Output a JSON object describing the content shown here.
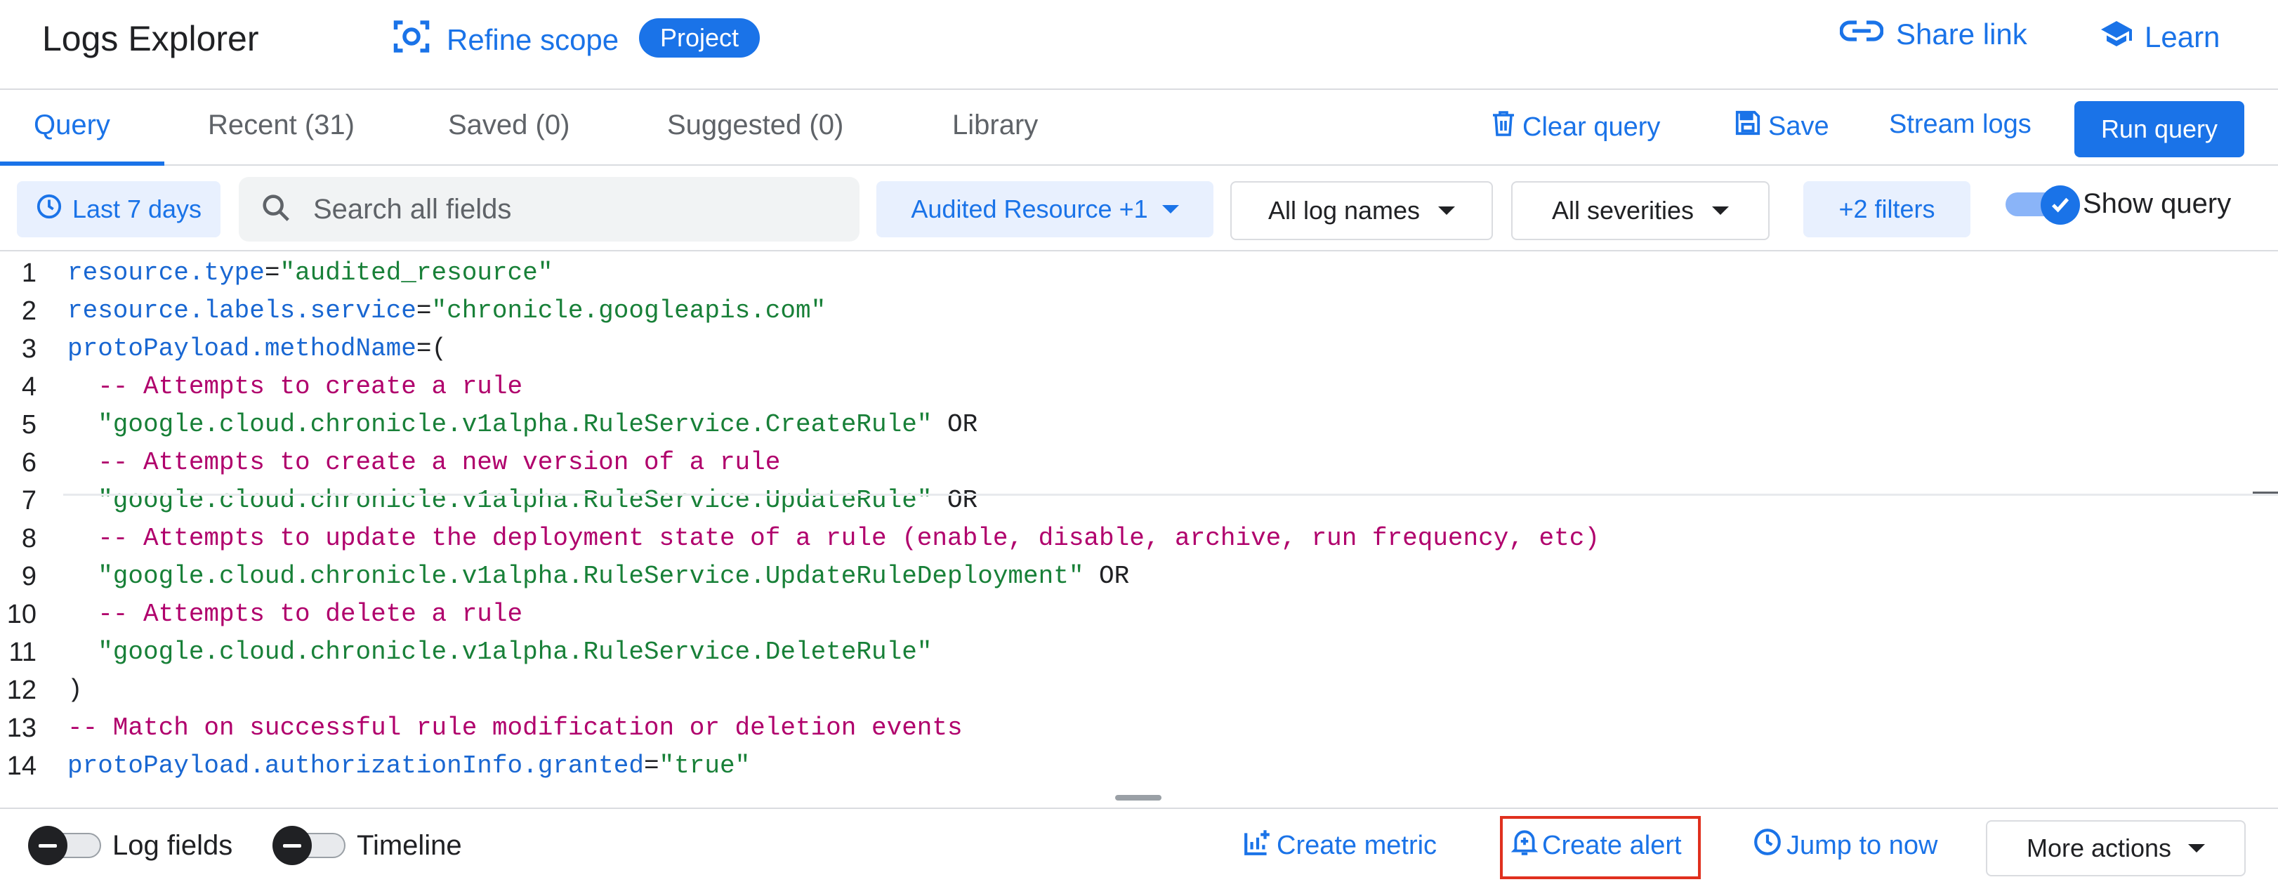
{
  "header": {
    "title": "Logs Explorer",
    "refine_scope": "Refine scope",
    "project_badge": "Project",
    "share_link": "Share link",
    "learn": "Learn"
  },
  "tabs": {
    "items": [
      {
        "label": "Query",
        "active": true
      },
      {
        "label": "Recent (31)"
      },
      {
        "label": "Saved (0)"
      },
      {
        "label": "Suggested (0)"
      },
      {
        "label": "Library"
      }
    ],
    "clear_query": "Clear query",
    "save": "Save",
    "stream_logs": "Stream logs",
    "run_query": "Run query"
  },
  "filters": {
    "time_range": "Last 7 days",
    "search_placeholder": "Search all fields",
    "resource": "Audited Resource +1",
    "log_names": "All log names",
    "severities": "All severities",
    "more_filters": "+2 filters",
    "show_query": "Show query"
  },
  "editor": {
    "lines": [
      {
        "n": "1",
        "segments": [
          {
            "t": "field",
            "v": "resource.type"
          },
          {
            "t": "op",
            "v": "="
          },
          {
            "t": "str",
            "v": "\"audited_resource\""
          }
        ]
      },
      {
        "n": "2",
        "segments": [
          {
            "t": "field",
            "v": "resource.labels.service"
          },
          {
            "t": "op",
            "v": "="
          },
          {
            "t": "str",
            "v": "\"chronicle.googleapis.com\""
          }
        ]
      },
      {
        "n": "3",
        "segments": [
          {
            "t": "field",
            "v": "protoPayload.methodName"
          },
          {
            "t": "op",
            "v": "=("
          }
        ]
      },
      {
        "n": "4",
        "segments": [
          {
            "t": "comment",
            "v": "  -- Attempts to create a rule"
          }
        ]
      },
      {
        "n": "5",
        "segments": [
          {
            "t": "str",
            "v": "  \"google.cloud.chronicle.v1alpha.RuleService.CreateRule\""
          },
          {
            "t": "op",
            "v": " OR"
          }
        ]
      },
      {
        "n": "6",
        "segments": [
          {
            "t": "comment",
            "v": "  -- Attempts to create a new version of a rule"
          }
        ]
      },
      {
        "n": "7",
        "segments": [
          {
            "t": "str",
            "v": "  \"google.cloud.chronicle.v1alpha.RuleService.UpdateRule\""
          },
          {
            "t": "op",
            "v": " OR"
          }
        ]
      },
      {
        "n": "8",
        "segments": [
          {
            "t": "comment",
            "v": "  -- Attempts to update the deployment state of a rule (enable, disable, archive, run frequency, etc)"
          }
        ]
      },
      {
        "n": "9",
        "segments": [
          {
            "t": "str",
            "v": "  \"google.cloud.chronicle.v1alpha.RuleService.UpdateRuleDeployment\""
          },
          {
            "t": "op",
            "v": " OR"
          }
        ]
      },
      {
        "n": "10",
        "segments": [
          {
            "t": "comment",
            "v": "  -- Attempts to delete a rule"
          }
        ]
      },
      {
        "n": "11",
        "segments": [
          {
            "t": "str",
            "v": "  \"google.cloud.chronicle.v1alpha.RuleService.DeleteRule\""
          }
        ]
      },
      {
        "n": "12",
        "segments": [
          {
            "t": "op",
            "v": ")"
          }
        ]
      },
      {
        "n": "13",
        "segments": [
          {
            "t": "comment",
            "v": "-- Match on successful rule modification or deletion events"
          }
        ]
      },
      {
        "n": "14",
        "segments": [
          {
            "t": "field",
            "v": "protoPayload.authorizationInfo.granted"
          },
          {
            "t": "op",
            "v": "="
          },
          {
            "t": "str",
            "v": "\"true\""
          }
        ]
      }
    ]
  },
  "bottom": {
    "log_fields": "Log fields",
    "timeline": "Timeline",
    "create_metric": "Create metric",
    "create_alert": "Create alert",
    "jump_to_now": "Jump to now",
    "more_actions": "More actions"
  },
  "colors": {
    "accent": "#1a73e8",
    "code_field": "#1967d2",
    "code_string": "#188038",
    "code_comment": "#b0006c",
    "highlight": "#e0301e"
  }
}
